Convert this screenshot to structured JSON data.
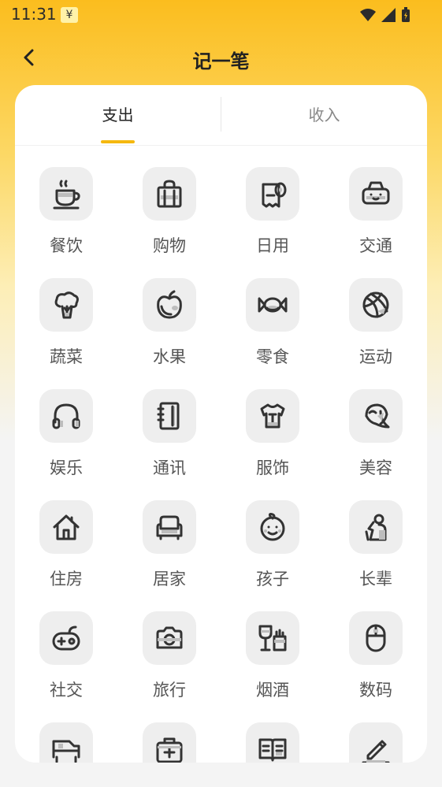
{
  "status_bar": {
    "time": "11:31",
    "notification_badge": "¥"
  },
  "nav": {
    "title": "记一笔",
    "back_icon": "chevron-left-icon"
  },
  "tabs": [
    {
      "label": "支出",
      "active": true
    },
    {
      "label": "收入",
      "active": false
    }
  ],
  "colors": {
    "accent": "#f5b80f",
    "header_gradient_top": "#fbbd1e",
    "icon_bg": "#eeeeee",
    "icon_stroke": "#333333"
  },
  "categories": [
    {
      "label": "餐饮",
      "icon": "coffee-cup-icon"
    },
    {
      "label": "购物",
      "icon": "shopping-bag-icon"
    },
    {
      "label": "日用",
      "icon": "toilet-paper-icon"
    },
    {
      "label": "交通",
      "icon": "car-icon"
    },
    {
      "label": "蔬菜",
      "icon": "broccoli-icon"
    },
    {
      "label": "水果",
      "icon": "apple-icon"
    },
    {
      "label": "零食",
      "icon": "candy-icon"
    },
    {
      "label": "运动",
      "icon": "basketball-icon"
    },
    {
      "label": "娱乐",
      "icon": "headphones-icon"
    },
    {
      "label": "通讯",
      "icon": "address-book-icon"
    },
    {
      "label": "服饰",
      "icon": "tshirt-icon"
    },
    {
      "label": "美容",
      "icon": "face-mask-icon"
    },
    {
      "label": "住房",
      "icon": "house-icon"
    },
    {
      "label": "居家",
      "icon": "sofa-icon"
    },
    {
      "label": "孩子",
      "icon": "baby-face-icon"
    },
    {
      "label": "长辈",
      "icon": "elder-icon"
    },
    {
      "label": "社交",
      "icon": "gamepad-icon"
    },
    {
      "label": "旅行",
      "icon": "camera-icon"
    },
    {
      "label": "烟酒",
      "icon": "wine-cigarette-icon"
    },
    {
      "label": "数码",
      "icon": "mouse-icon"
    },
    {
      "label": "",
      "icon": "truck-icon"
    },
    {
      "label": "",
      "icon": "medical-kit-icon"
    },
    {
      "label": "",
      "icon": "book-icon"
    },
    {
      "label": "",
      "icon": "pencil-icon"
    }
  ]
}
